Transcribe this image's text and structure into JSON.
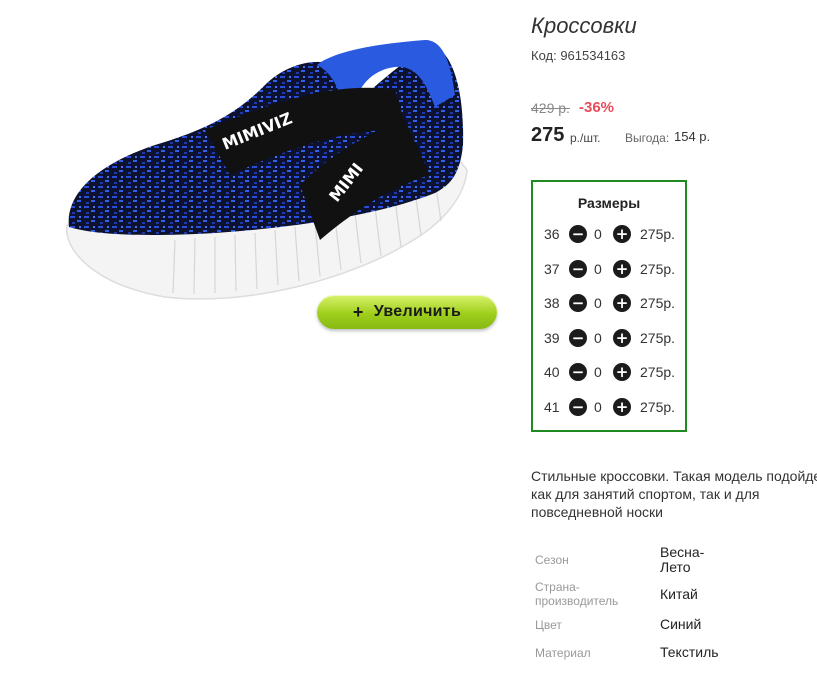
{
  "product": {
    "title": "Кроссовки",
    "code": "Код: 961534163",
    "zoom_label": "Увеличить",
    "zoom_plus": "+"
  },
  "price": {
    "old": "429 р.",
    "discount": "-36%",
    "current": "275",
    "unit": "р./шт.",
    "benefit_label": "Выгода:",
    "benefit_value": "154 р."
  },
  "sizes": {
    "title": "Размеры",
    "minus": "−",
    "plus": "+",
    "rows": [
      {
        "size": "36",
        "qty": "0",
        "price": "275р."
      },
      {
        "size": "37",
        "qty": "0",
        "price": "275р."
      },
      {
        "size": "38",
        "qty": "0",
        "price": "275р."
      },
      {
        "size": "39",
        "qty": "0",
        "price": "275р."
      },
      {
        "size": "40",
        "qty": "0",
        "price": "275р."
      },
      {
        "size": "41",
        "qty": "0",
        "price": "275р."
      }
    ]
  },
  "description": {
    "lines": [
      "Стильные кроссовки. Такая модель подойдет",
      "как для занятий спортом, так и для",
      "повседневной носки"
    ]
  },
  "specs": [
    {
      "label": "Сезон",
      "value": "Весна-Лето",
      "label_lines": [
        "Сезон"
      ],
      "value_lines": [
        "Весна-",
        "Лето"
      ]
    },
    {
      "label": "Страна-производитель",
      "value": "Китай",
      "label_lines": [
        "Страна-",
        "производитель"
      ],
      "value_lines": [
        "Китай"
      ]
    },
    {
      "label": "Цвет",
      "value": "Синий",
      "label_lines": [
        "Цвет"
      ],
      "value_lines": [
        "Синий"
      ]
    },
    {
      "label": "Материал",
      "value": "Текстиль",
      "label_lines": [
        "Материал"
      ],
      "value_lines": [
        "Текстиль"
      ]
    }
  ],
  "colors": {
    "accent_green": "#1f8a1f",
    "discount_red": "#e84c5a",
    "zoom_button": "#9fcf1c",
    "shoe_blue": "#2a4fd6"
  }
}
